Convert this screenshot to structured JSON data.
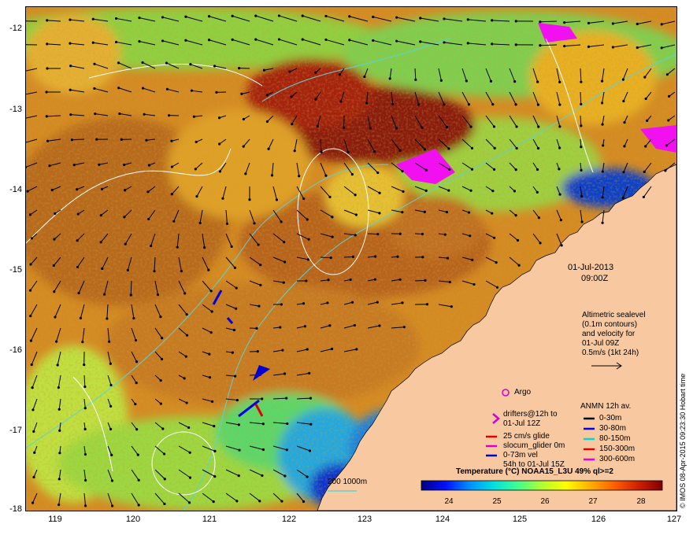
{
  "map": {
    "date": "01-Jul-2013",
    "time": "09:00Z",
    "lat_ticks": [
      "-12",
      "-13",
      "-14",
      "-15",
      "-16",
      "-17",
      "-18"
    ],
    "lon_ticks": [
      "119",
      "120",
      "121",
      "122",
      "123",
      "124",
      "125",
      "126",
      "127"
    ],
    "bathy_label": "200 1000m",
    "credit": "© IMOS 08-Apr-2015 09:23:30 Hobart time",
    "colors": {
      "land": "#f8c8a0",
      "shelf_cool": "#1a3cc8",
      "contour": "#5ed2d2",
      "sla_contour": "#ffffff"
    }
  },
  "legend_altimetry": {
    "lines": [
      "Altimetric sealevel",
      "(0.1m contours)",
      "and velocity for",
      "01-Jul 09Z",
      "0.5m/s (1kt 24h)"
    ]
  },
  "legend_argo": {
    "label": "Argo",
    "color": "#d400d4"
  },
  "legend_drifters": {
    "items": [
      {
        "label": "drifters@12h to",
        "label2": "01-Jul 12Z",
        "symbol": ">",
        "color": "#d400d4"
      },
      {
        "label": "25 cm/s glide",
        "color": "#e00000"
      },
      {
        "label": "slocum_glider 0m",
        "color": "#d400d4"
      },
      {
        "label": "0-73m vel",
        "label2": "54h to 01-Jul 15Z",
        "color": "#0000d0"
      }
    ]
  },
  "legend_anmn": {
    "title": "ANMN 12h av.",
    "items": [
      {
        "label": "0-30m",
        "color": "#000000"
      },
      {
        "label": "30-80m",
        "color": "#0000e0"
      },
      {
        "label": "80-150m",
        "color": "#00d8d8"
      },
      {
        "label": "150-300m",
        "color": "#e00000"
      },
      {
        "label": "300-600m",
        "color": "#e000e0"
      }
    ]
  },
  "colorbar": {
    "title": "Temperature (°C) NOAA15_L3U 49% ql>=2",
    "ticks": [
      "24",
      "25",
      "26",
      "27",
      "28"
    ],
    "stops": [
      "#000080",
      "#0010ff",
      "#0090ff",
      "#00e0e0",
      "#40ff90",
      "#b0ff30",
      "#ffff00",
      "#ffb000",
      "#ff6000",
      "#d02000",
      "#800000"
    ]
  }
}
